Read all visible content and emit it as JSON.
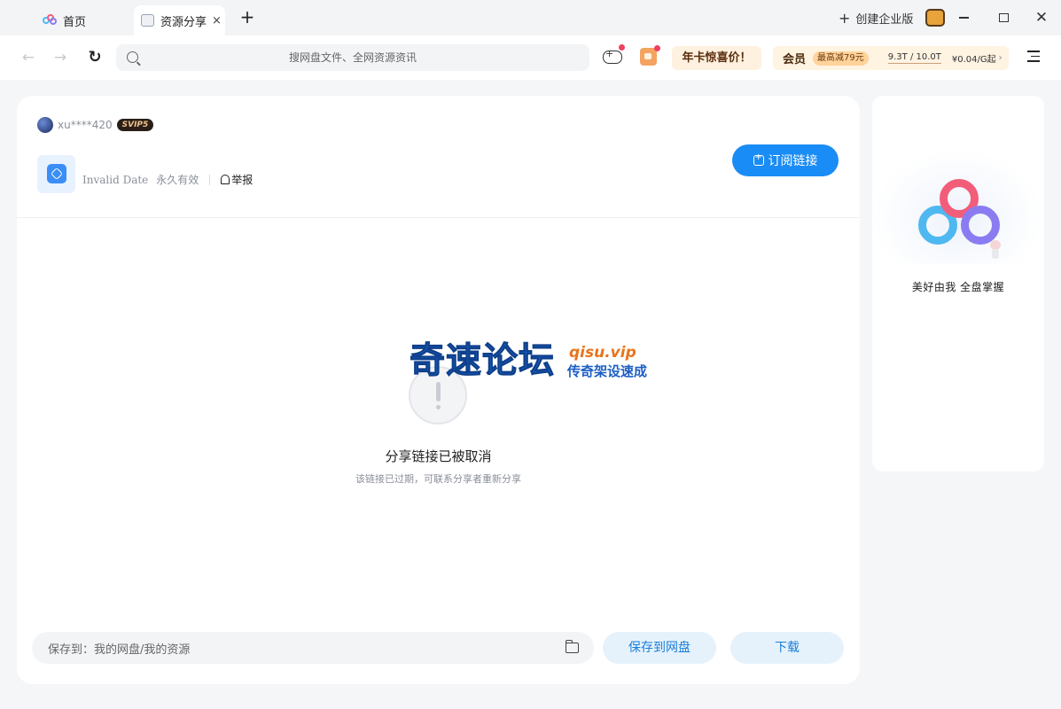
{
  "tabs": {
    "home_label": "首页",
    "share_label": "资源分享",
    "close_glyph": "×",
    "add_glyph": "+"
  },
  "titlebar": {
    "create_enterprise": "创建企业版",
    "plus_glyph": "+",
    "close_glyph": "✕"
  },
  "toolbar": {
    "back_glyph": "←",
    "forward_glyph": "→",
    "refresh_glyph": "↻",
    "search_placeholder": "搜网盘文件、全网资源资讯",
    "promo_label": "年卡惊喜价！",
    "member": {
      "label": "会员",
      "promo": "最高减79元",
      "storage": "9.3T / 10.0T",
      "price": "¥0.04/G起",
      "chevron": "›"
    }
  },
  "share": {
    "owner_name": "xu****420",
    "owner_badge": "SVIP5",
    "date": "Invalid Date",
    "validity": "永久有效",
    "report_label": "举报",
    "subscribe_label": "订阅链接",
    "error_title": "分享链接已被取消",
    "error_desc": "该链接已过期，可联系分享者重新分享",
    "save_path": "保存到：我的网盘/我的资源",
    "save_button": "保存到网盘",
    "download_button": "下载"
  },
  "watermark": {
    "main": "奇速论坛",
    "site": "qisu.vip",
    "slogan": "传奇架设速成"
  },
  "side": {
    "slogan": "美好由我  全盘掌握"
  },
  "colors": {
    "accent": "#1a8cf5",
    "alert_dot": "#f04060",
    "member_bg": "#fff3e2"
  }
}
